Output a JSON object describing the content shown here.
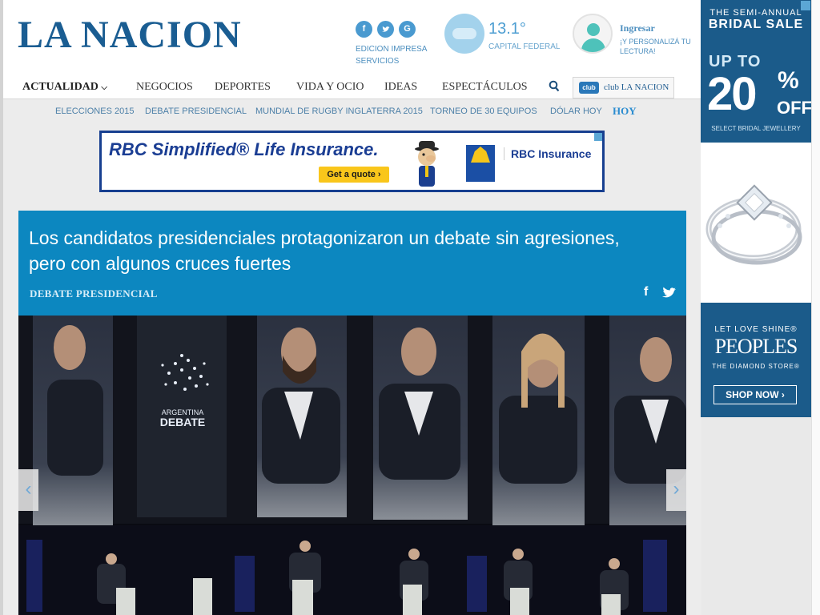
{
  "header": {
    "logo": "LA NACION",
    "social": {
      "facebook": "f",
      "twitter": "t",
      "google": "G"
    },
    "edition": "EDICION IMPRESA SERVICIOS",
    "weather": {
      "temp": "13.1°",
      "city": "CAPITAL FEDERAL"
    },
    "user": {
      "login": "Ingresar",
      "cta": "¡Y PERSONALIZÁ TU LECTURA!"
    }
  },
  "nav": {
    "items": [
      "ACTUALIDAD",
      "NEGOCIOS",
      "DEPORTES",
      "VIDA Y OCIO",
      "IDEAS",
      "ESPECTÁCULOS"
    ],
    "club_badge": "club",
    "club_label": "club LA NACION"
  },
  "subnav": {
    "items": [
      "ELECCIONES 2015",
      "DEBATE PRESIDENCIAL",
      "MUNDIAL DE RUGBY INGLATERRA 2015",
      "TORNEO DE 30 EQUIPOS",
      "DÓLAR HOY",
      "HOY"
    ]
  },
  "banner_ad": {
    "title": "RBC Simplified® Life Insurance.",
    "cta": "Get a quote ›",
    "brand": "RBC Insurance"
  },
  "article": {
    "headline": "Los candidatos presidenciales protagonizaron un debate sin agresiones, pero con algunos cruces fuertes",
    "section": "DEBATE PRESIDENCIAL"
  },
  "hero": {
    "screen_logo_line1": "ARGENTINA",
    "screen_logo_line2": "DEBATE",
    "prev": "‹",
    "next": "›"
  },
  "side_ad": {
    "top_small": "THE SEMI-ANNUAL",
    "top_big": "BRIDAL SALE",
    "upto": "UP TO",
    "percent": "20",
    "percent_symbol": "%",
    "off": "OFF",
    "select": "SELECT BRIDAL JEWELLERY",
    "let_love": "LET LOVE SHINE®",
    "peoples": "PEOPLES",
    "diamond_store": "THE DIAMOND STORE®",
    "shop": "SHOP NOW ›"
  },
  "colors": {
    "brand": "#1a5d92",
    "headline_bg": "#0c87c0",
    "ad_blue": "#1b5b8a"
  }
}
